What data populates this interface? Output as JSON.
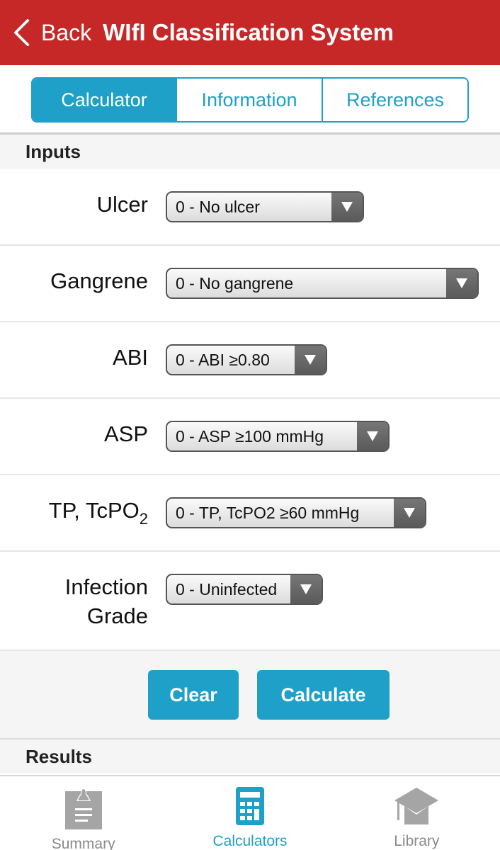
{
  "navbar": {
    "back_label": "Back",
    "title": "WIfI Classification System",
    "color": "#c62828"
  },
  "segments": [
    {
      "label": "Calculator",
      "active": true
    },
    {
      "label": "Information",
      "active": false
    },
    {
      "label": "References",
      "active": false
    }
  ],
  "accent_color": "#1fa0c8",
  "inputs": {
    "header": "Inputs",
    "fields": [
      {
        "label": "Ulcer",
        "value": "0 - No ulcer"
      },
      {
        "label": "Gangrene",
        "value": "0 - No gangrene"
      },
      {
        "label": "ABI",
        "value": "0 - ABI ≥0.80"
      },
      {
        "label": "ASP",
        "value": "0 - ASP ≥100 mmHg"
      },
      {
        "label_main": "TP, TcPO",
        "label_sub": "2",
        "value": "0 - TP, TcPO2 ≥60 mmHg"
      },
      {
        "label_line1": "Infection",
        "label_line2": "Grade",
        "value": "0 - Uninfected"
      }
    ]
  },
  "buttons": {
    "clear": "Clear",
    "calculate": "Calculate"
  },
  "results": {
    "header": "Results"
  },
  "tabbar": {
    "items": [
      {
        "label": "Summary",
        "icon": "clipboard-icon",
        "active": false
      },
      {
        "label": "Calculators",
        "icon": "calculator-icon",
        "active": true
      },
      {
        "label": "Library",
        "icon": "graduation-cap-icon",
        "active": false
      }
    ]
  }
}
